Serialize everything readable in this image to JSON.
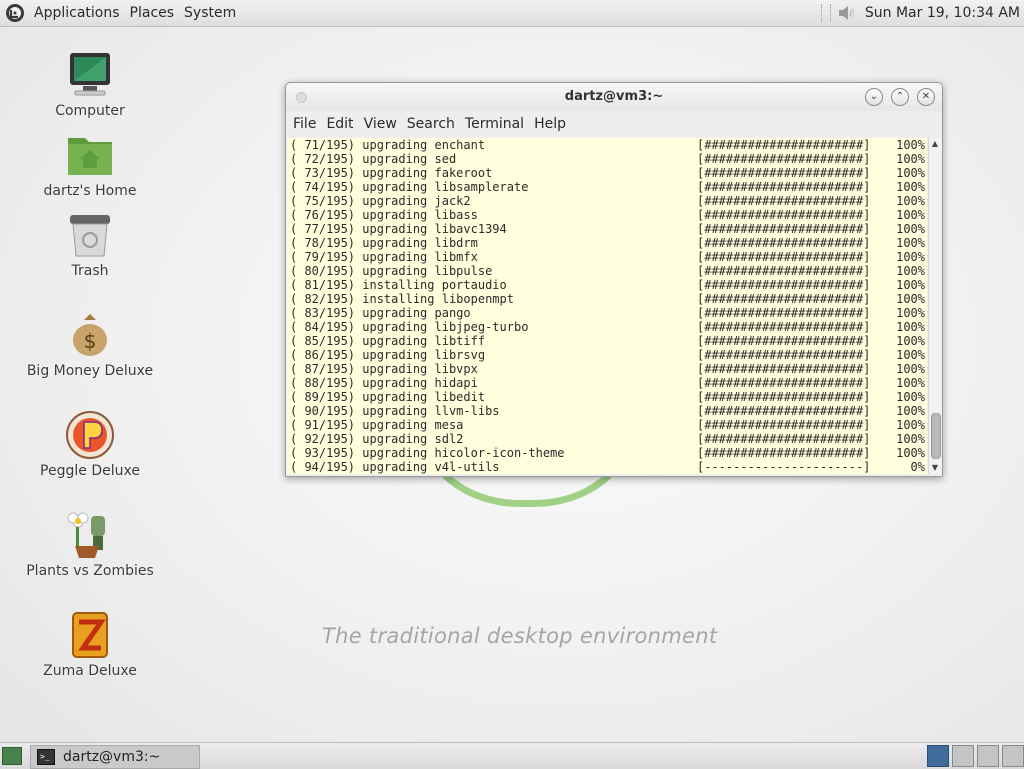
{
  "top_panel": {
    "menus": [
      "Applications",
      "Places",
      "System"
    ],
    "clock": "Sun Mar 19, 10:34 AM"
  },
  "desktop": {
    "tagline": "The traditional desktop environment",
    "icons": [
      {
        "label": "Computer",
        "icon": "computer-icon"
      },
      {
        "label": "dartz's Home",
        "icon": "home-folder-icon"
      },
      {
        "label": "Trash",
        "icon": "trash-icon"
      },
      {
        "label": "Big Money Deluxe",
        "icon": "money-bag-icon"
      },
      {
        "label": "Peggle Deluxe",
        "icon": "peggle-icon"
      },
      {
        "label": "Plants vs Zombies",
        "icon": "plants-vs-zombies-icon"
      },
      {
        "label": "Zuma Deluxe",
        "icon": "zuma-icon"
      }
    ]
  },
  "terminal": {
    "title": "dartz@vm3:~",
    "menus": [
      "File",
      "Edit",
      "View",
      "Search",
      "Terminal",
      "Help"
    ],
    "lines": [
      {
        "text": "( 71/195) upgrading enchant",
        "bar": "[######################]",
        "pct": "100%"
      },
      {
        "text": "( 72/195) upgrading sed",
        "bar": "[######################]",
        "pct": "100%"
      },
      {
        "text": "( 73/195) upgrading fakeroot",
        "bar": "[######################]",
        "pct": "100%"
      },
      {
        "text": "( 74/195) upgrading libsamplerate",
        "bar": "[######################]",
        "pct": "100%"
      },
      {
        "text": "( 75/195) upgrading jack2",
        "bar": "[######################]",
        "pct": "100%"
      },
      {
        "text": "( 76/195) upgrading libass",
        "bar": "[######################]",
        "pct": "100%"
      },
      {
        "text": "( 77/195) upgrading libavc1394",
        "bar": "[######################]",
        "pct": "100%"
      },
      {
        "text": "( 78/195) upgrading libdrm",
        "bar": "[######################]",
        "pct": "100%"
      },
      {
        "text": "( 79/195) upgrading libmfx",
        "bar": "[######################]",
        "pct": "100%"
      },
      {
        "text": "( 80/195) upgrading libpulse",
        "bar": "[######################]",
        "pct": "100%"
      },
      {
        "text": "( 81/195) installing portaudio",
        "bar": "[######################]",
        "pct": "100%"
      },
      {
        "text": "( 82/195) installing libopenmpt",
        "bar": "[######################]",
        "pct": "100%"
      },
      {
        "text": "( 83/195) upgrading pango",
        "bar": "[######################]",
        "pct": "100%"
      },
      {
        "text": "( 84/195) upgrading libjpeg-turbo",
        "bar": "[######################]",
        "pct": "100%"
      },
      {
        "text": "( 85/195) upgrading libtiff",
        "bar": "[######################]",
        "pct": "100%"
      },
      {
        "text": "( 86/195) upgrading librsvg",
        "bar": "[######################]",
        "pct": "100%"
      },
      {
        "text": "( 87/195) upgrading libvpx",
        "bar": "[######################]",
        "pct": "100%"
      },
      {
        "text": "( 88/195) upgrading hidapi",
        "bar": "[######################]",
        "pct": "100%"
      },
      {
        "text": "( 89/195) upgrading libedit",
        "bar": "[######################]",
        "pct": "100%"
      },
      {
        "text": "( 90/195) upgrading llvm-libs",
        "bar": "[######################]",
        "pct": "100%"
      },
      {
        "text": "( 91/195) upgrading mesa",
        "bar": "[######################]",
        "pct": "100%"
      },
      {
        "text": "( 92/195) upgrading sdl2",
        "bar": "[######################]",
        "pct": "100%"
      },
      {
        "text": "( 93/195) upgrading hicolor-icon-theme",
        "bar": "[######################]",
        "pct": "100%"
      },
      {
        "text": "( 94/195) upgrading v4l-utils",
        "bar": "[----------------------]",
        "pct": "0%"
      }
    ]
  },
  "bottom_panel": {
    "task_label": "dartz@vm3:~"
  },
  "colors": {
    "terminal_bg": "#ffffdd",
    "accent_green": "#8cc96b",
    "workspace_active": "#3f6b9a"
  }
}
